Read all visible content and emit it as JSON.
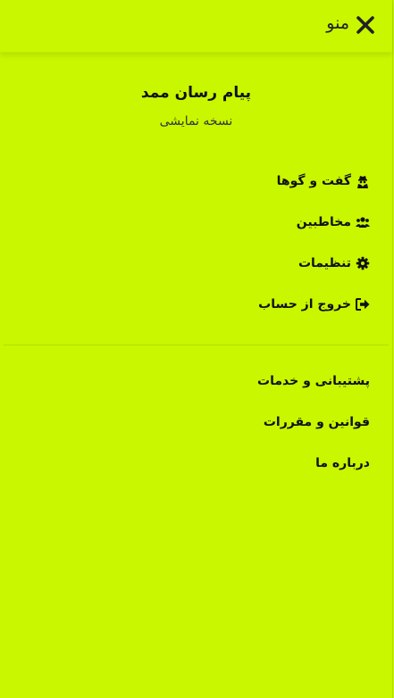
{
  "header": {
    "title": "منو",
    "close_icon": "close-icon"
  },
  "profile": {
    "name": "پیام رسان ممد",
    "subtitle": "نسخه نمایشی"
  },
  "menu": {
    "items": [
      {
        "label": "گفت و گوها",
        "icon": "user-secret-icon"
      },
      {
        "label": "مخاطبین",
        "icon": "users-icon"
      },
      {
        "label": "تنظیمات",
        "icon": "gear-icon"
      },
      {
        "label": "خروج از حساب",
        "icon": "sign-out-icon"
      }
    ]
  },
  "secondary_menu": {
    "items": [
      {
        "label": "پشتیبانی و خدمات"
      },
      {
        "label": "قوانین و مقررات"
      },
      {
        "label": "درباره ما"
      }
    ]
  },
  "colors": {
    "background": "#c8f700",
    "text": "#111111"
  }
}
